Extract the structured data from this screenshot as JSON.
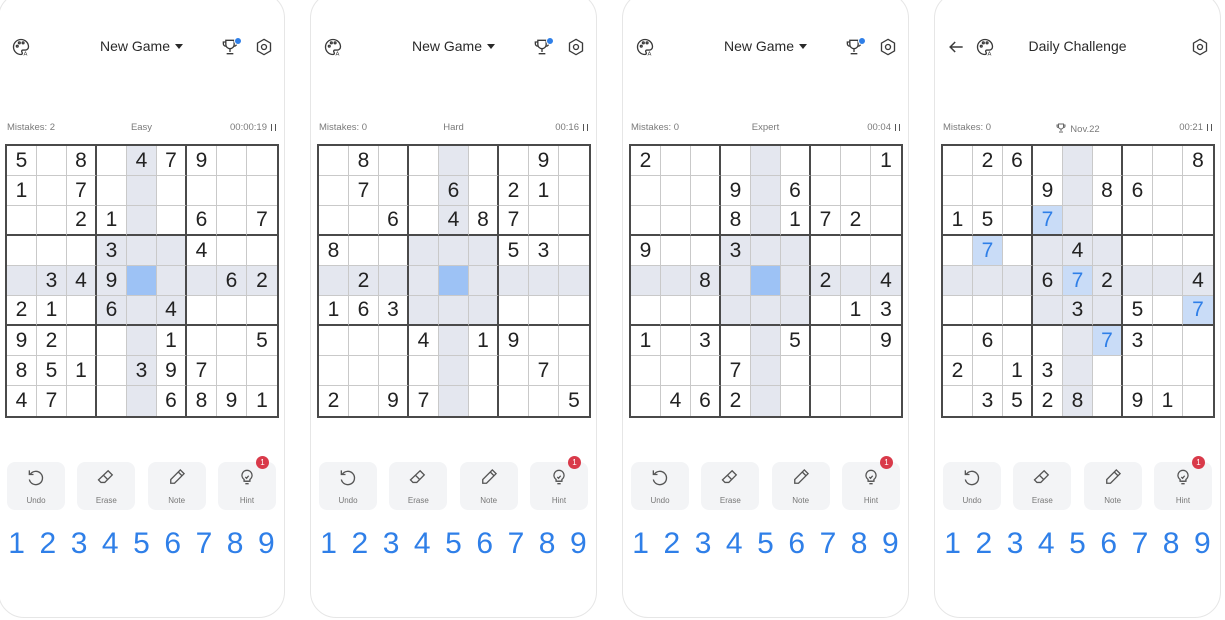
{
  "colors": {
    "accent": "#2f7fe8",
    "highlight": "#e4e7ef",
    "selected": "#9dc2f5",
    "badge": "#d93a4a"
  },
  "screens": [
    {
      "title": "New Game",
      "has_back": false,
      "has_trophy": true,
      "mistakes": "Mistakes: 2",
      "mid": "Easy",
      "time": "00:00:19",
      "mid_trophy": false,
      "grid": [
        [
          "5",
          "",
          "8",
          "",
          "4",
          "7",
          "9",
          "",
          ""
        ],
        [
          "1",
          "",
          "7",
          "",
          "",
          "",
          "",
          "",
          ""
        ],
        [
          "",
          "",
          "2",
          "1",
          "",
          "",
          "6",
          "",
          "7"
        ],
        [
          "",
          "",
          "",
          "3",
          "",
          "",
          "4",
          "",
          ""
        ],
        [
          "",
          "3",
          "4",
          "9",
          "",
          "",
          "",
          "6",
          "2"
        ],
        [
          "2",
          "1",
          "",
          "6",
          "",
          "4",
          "",
          "",
          ""
        ],
        [
          "9",
          "2",
          "",
          "",
          "",
          "1",
          "",
          "",
          "5"
        ],
        [
          "8",
          "5",
          "1",
          "",
          "3",
          "9",
          "7",
          "",
          ""
        ],
        [
          "4",
          "7",
          "",
          "",
          "",
          "6",
          "8",
          "9",
          "1"
        ]
      ],
      "highlight": [
        [
          0,
          4
        ],
        [
          1,
          4
        ],
        [
          2,
          4
        ],
        [
          3,
          4
        ],
        [
          5,
          4
        ],
        [
          6,
          4
        ],
        [
          7,
          4
        ],
        [
          8,
          4
        ],
        [
          4,
          0
        ],
        [
          4,
          1
        ],
        [
          4,
          2
        ],
        [
          4,
          3
        ],
        [
          4,
          5
        ],
        [
          4,
          6
        ],
        [
          4,
          7
        ],
        [
          4,
          8
        ],
        [
          3,
          3
        ],
        [
          3,
          5
        ],
        [
          5,
          3
        ],
        [
          5,
          5
        ]
      ],
      "selected": [
        4,
        4
      ],
      "entered": [],
      "entered_sel": []
    },
    {
      "title": "New Game",
      "has_back": false,
      "has_trophy": true,
      "mistakes": "Mistakes: 0",
      "mid": "Hard",
      "time": "00:16",
      "mid_trophy": false,
      "grid": [
        [
          "",
          "8",
          "",
          "",
          "",
          "",
          "",
          "9",
          ""
        ],
        [
          "",
          "7",
          "",
          "",
          "6",
          "",
          "2",
          "1",
          ""
        ],
        [
          "",
          "",
          "6",
          "",
          "4",
          "8",
          "7",
          "",
          ""
        ],
        [
          "8",
          "",
          "",
          "",
          "",
          "",
          "5",
          "3",
          ""
        ],
        [
          "",
          "2",
          "",
          "",
          "",
          "",
          "",
          "",
          ""
        ],
        [
          "1",
          "6",
          "3",
          "",
          "",
          "",
          "",
          "",
          ""
        ],
        [
          "",
          "",
          "",
          "4",
          "",
          "1",
          "9",
          "",
          ""
        ],
        [
          "",
          "",
          "",
          "",
          "",
          "",
          "",
          "7",
          ""
        ],
        [
          "2",
          "",
          "9",
          "7",
          "",
          "",
          "",
          "",
          "5"
        ]
      ],
      "highlight": [
        [
          0,
          4
        ],
        [
          1,
          4
        ],
        [
          2,
          4
        ],
        [
          3,
          4
        ],
        [
          5,
          4
        ],
        [
          6,
          4
        ],
        [
          7,
          4
        ],
        [
          8,
          4
        ],
        [
          4,
          0
        ],
        [
          4,
          1
        ],
        [
          4,
          2
        ],
        [
          4,
          3
        ],
        [
          4,
          5
        ],
        [
          4,
          6
        ],
        [
          4,
          7
        ],
        [
          4,
          8
        ],
        [
          3,
          3
        ],
        [
          3,
          5
        ],
        [
          5,
          3
        ],
        [
          5,
          5
        ]
      ],
      "selected": [
        4,
        4
      ],
      "entered": [],
      "entered_sel": []
    },
    {
      "title": "New Game",
      "has_back": false,
      "has_trophy": true,
      "mistakes": "Mistakes: 0",
      "mid": "Expert",
      "time": "00:04",
      "mid_trophy": false,
      "grid": [
        [
          "2",
          "",
          "",
          "",
          "",
          "",
          "",
          "",
          "1"
        ],
        [
          "",
          "",
          "",
          "9",
          "",
          "6",
          "",
          "",
          ""
        ],
        [
          "",
          "",
          "",
          "8",
          "",
          "1",
          "7",
          "2",
          ""
        ],
        [
          "9",
          "",
          "",
          "3",
          "",
          "",
          "",
          "",
          ""
        ],
        [
          "",
          "",
          "8",
          "",
          "",
          "",
          "2",
          "",
          "4"
        ],
        [
          "",
          "",
          "",
          "",
          "",
          "",
          "",
          "1",
          "3"
        ],
        [
          "1",
          "",
          "3",
          "",
          "",
          "5",
          "",
          "",
          "9"
        ],
        [
          "",
          "",
          "",
          "7",
          "",
          "",
          "",
          "",
          ""
        ],
        [
          "",
          "4",
          "6",
          "2",
          "",
          "",
          "",
          "",
          ""
        ]
      ],
      "highlight": [
        [
          0,
          4
        ],
        [
          1,
          4
        ],
        [
          2,
          4
        ],
        [
          3,
          4
        ],
        [
          5,
          4
        ],
        [
          6,
          4
        ],
        [
          7,
          4
        ],
        [
          8,
          4
        ],
        [
          4,
          0
        ],
        [
          4,
          1
        ],
        [
          4,
          2
        ],
        [
          4,
          3
        ],
        [
          4,
          5
        ],
        [
          4,
          6
        ],
        [
          4,
          7
        ],
        [
          4,
          8
        ],
        [
          3,
          3
        ],
        [
          3,
          5
        ],
        [
          5,
          3
        ],
        [
          5,
          5
        ]
      ],
      "selected": [
        4,
        4
      ],
      "entered": [],
      "entered_sel": []
    },
    {
      "title": "Daily Challenge",
      "has_back": true,
      "has_trophy": false,
      "mistakes": "Mistakes: 0",
      "mid": "Nov.22",
      "time": "00:21",
      "mid_trophy": true,
      "grid": [
        [
          "",
          "2",
          "6",
          "",
          "",
          "",
          "",
          "",
          "8"
        ],
        [
          "",
          "",
          "",
          "9",
          "",
          "8",
          "6",
          "",
          ""
        ],
        [
          "1",
          "5",
          "",
          "7",
          "",
          "",
          "",
          "",
          ""
        ],
        [
          "",
          "7",
          "",
          "",
          "4",
          "",
          "",
          "",
          ""
        ],
        [
          "",
          "",
          "",
          "6",
          "7",
          "2",
          "",
          "",
          "4"
        ],
        [
          "",
          "",
          "",
          "",
          "3",
          "",
          "5",
          "",
          "7"
        ],
        [
          "",
          "6",
          "",
          "",
          "",
          "7",
          "3",
          "",
          ""
        ],
        [
          "2",
          "",
          "1",
          "3",
          "",
          "",
          "",
          "",
          ""
        ],
        [
          "",
          "3",
          "5",
          "2",
          "8",
          "",
          "9",
          "1",
          ""
        ]
      ],
      "highlight": [
        [
          0,
          4
        ],
        [
          1,
          4
        ],
        [
          2,
          4
        ],
        [
          3,
          4
        ],
        [
          5,
          4
        ],
        [
          6,
          4
        ],
        [
          7,
          4
        ],
        [
          8,
          4
        ],
        [
          4,
          0
        ],
        [
          4,
          1
        ],
        [
          4,
          2
        ],
        [
          4,
          3
        ],
        [
          4,
          5
        ],
        [
          4,
          6
        ],
        [
          4,
          7
        ],
        [
          4,
          8
        ],
        [
          3,
          3
        ],
        [
          3,
          5
        ],
        [
          5,
          3
        ],
        [
          5,
          5
        ]
      ],
      "selected": [],
      "entered": [
        [
          2,
          3
        ],
        [
          3,
          1
        ],
        [
          4,
          4
        ],
        [
          5,
          8
        ],
        [
          6,
          5
        ]
      ],
      "entered_sel": [
        [
          2,
          3
        ],
        [
          3,
          1
        ],
        [
          4,
          4
        ],
        [
          5,
          8
        ],
        [
          6,
          5
        ]
      ]
    }
  ],
  "tools": {
    "undo": "Undo",
    "erase": "Erase",
    "note": "Note",
    "hint": "Hint",
    "hint_count": "1"
  },
  "numbers": [
    "1",
    "2",
    "3",
    "4",
    "5",
    "6",
    "7",
    "8",
    "9"
  ]
}
